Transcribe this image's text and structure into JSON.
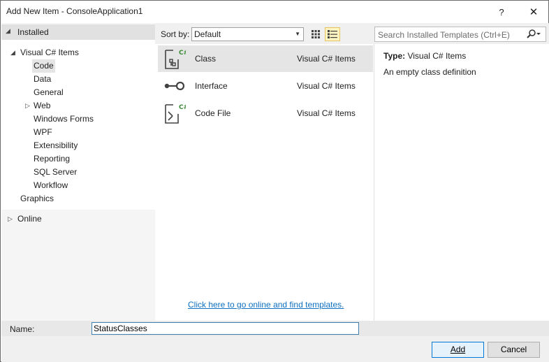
{
  "window": {
    "title": "Add New Item - ConsoleApplication1",
    "help_label": "?",
    "close_label": "✕"
  },
  "left": {
    "installed_label": "Installed",
    "tree": {
      "root_label": "Visual C# Items",
      "items": [
        {
          "label": "Code"
        },
        {
          "label": "Data"
        },
        {
          "label": "General"
        },
        {
          "label": "Web"
        },
        {
          "label": "Windows Forms"
        },
        {
          "label": "WPF"
        },
        {
          "label": "Extensibility"
        },
        {
          "label": "Reporting"
        },
        {
          "label": "SQL Server"
        },
        {
          "label": "Workflow"
        }
      ],
      "graphics_label": "Graphics"
    },
    "online_label": "Online"
  },
  "toolbar": {
    "sort_label": "Sort by:",
    "sort_value": "Default",
    "search_placeholder": "Search Installed Templates (Ctrl+E)"
  },
  "templates": [
    {
      "name": "Class",
      "category": "Visual C# Items",
      "icon": "class-icon"
    },
    {
      "name": "Interface",
      "category": "Visual C# Items",
      "icon": "interface-icon"
    },
    {
      "name": "Code File",
      "category": "Visual C# Items",
      "icon": "code-file-icon"
    }
  ],
  "online_link": "Click here to go online and find templates.",
  "details": {
    "type_label": "Type:",
    "type_value": "Visual C# Items",
    "description": "An empty class definition"
  },
  "bottom": {
    "name_label": "Name:",
    "name_value": "StatusClasses",
    "add_label": "Add",
    "cancel_label": "Cancel"
  },
  "colors": {
    "accent": "#0078d7",
    "link": "#0e70c0",
    "csharp_green": "#388a34"
  }
}
